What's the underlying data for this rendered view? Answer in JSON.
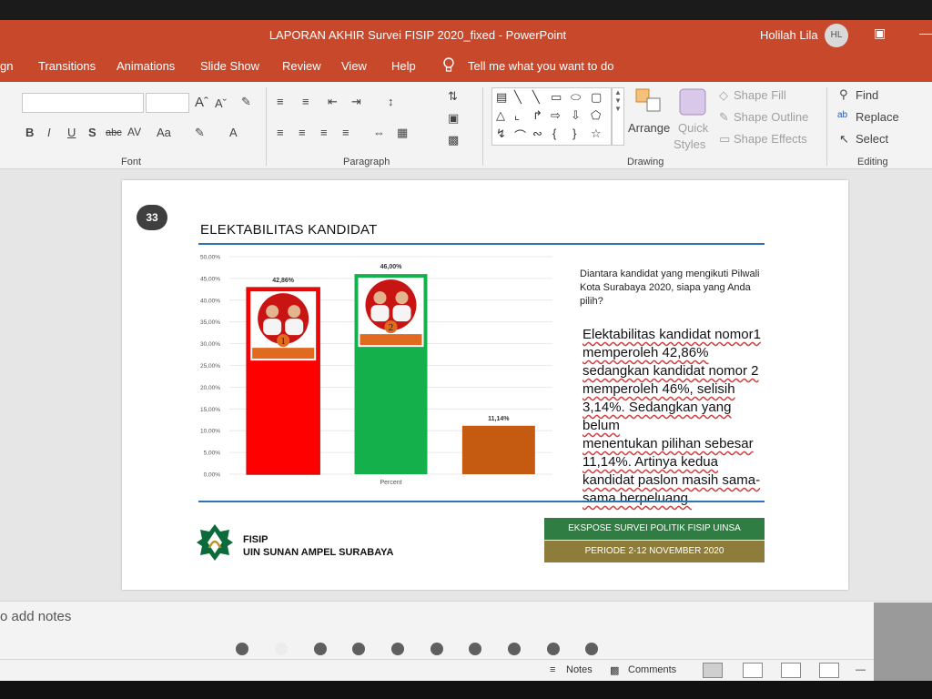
{
  "window": {
    "title": "LAPORAN AKHIR Survei FISIP 2020_fixed  -  PowerPoint",
    "user_name": "Holilah Lila",
    "user_initials": "HL"
  },
  "ribbon_tabs": [
    "gn",
    "Transitions",
    "Animations",
    "Slide Show",
    "Review",
    "View",
    "Help"
  ],
  "tell_me": "Tell me what you want to do",
  "ribbon": {
    "groups": {
      "font": "Font",
      "paragraph": "Paragraph",
      "drawing": "Drawing",
      "editing": "Editing"
    },
    "arrange": "Arrange",
    "quick_styles_1": "Quick",
    "quick_styles_2": "Styles",
    "shape_fill": "Shape Fill",
    "shape_outline": "Shape Outline",
    "shape_effects": "Shape Effects",
    "find": "Find",
    "replace": "Replace",
    "select": "Select"
  },
  "slide": {
    "number": "33",
    "title": "ELEKTABILITAS KANDIDAT",
    "question": "Diantara kandidat yang mengikuti Pilwali Kota Surabaya 2020, siapa yang Anda pilih?",
    "body_lines": [
      "Elektabilitas kandidat nomor1",
      "memperoleh 42,86%",
      "sedangkan kandidat nomor 2",
      "memperoleh 46%, selisih",
      "3,14%. Sedangkan yang belum",
      "menentukan pilihan sebesar",
      "11,14%. Artinya kedua",
      "kandidat paslon masih sama-",
      "sama berpeluang."
    ],
    "logo_line1": "FISIP",
    "logo_line2": "UIN SUNAN AMPEL SURABAYA",
    "banner_top": "EKSPOSE SURVEI POLITIK FISIP UINSA",
    "banner_bottom": "PERIODE 2-12 NOVEMBER 2020"
  },
  "chart_data": {
    "type": "bar",
    "categories": [
      "1",
      "2",
      ""
    ],
    "values": [
      42.86,
      46.0,
      11.14
    ],
    "value_labels": [
      "42,86%",
      "46,00%",
      "11,14%"
    ],
    "colors": [
      "#fe0000",
      "#13b04b",
      "#c55a11"
    ],
    "yticks": [
      "0,00%",
      "5,00%",
      "10,00%",
      "15,00%",
      "20,00%",
      "25,00%",
      "30,00%",
      "35,00%",
      "40,00%",
      "45,00%",
      "50,00%"
    ],
    "ylim": [
      0,
      50
    ],
    "xlabel": "Percent",
    "candidate_numbers": [
      "1",
      "2"
    ],
    "grid": true
  },
  "notes_hint": "o add notes",
  "status": {
    "notes": "Notes",
    "comments": "Comments"
  }
}
